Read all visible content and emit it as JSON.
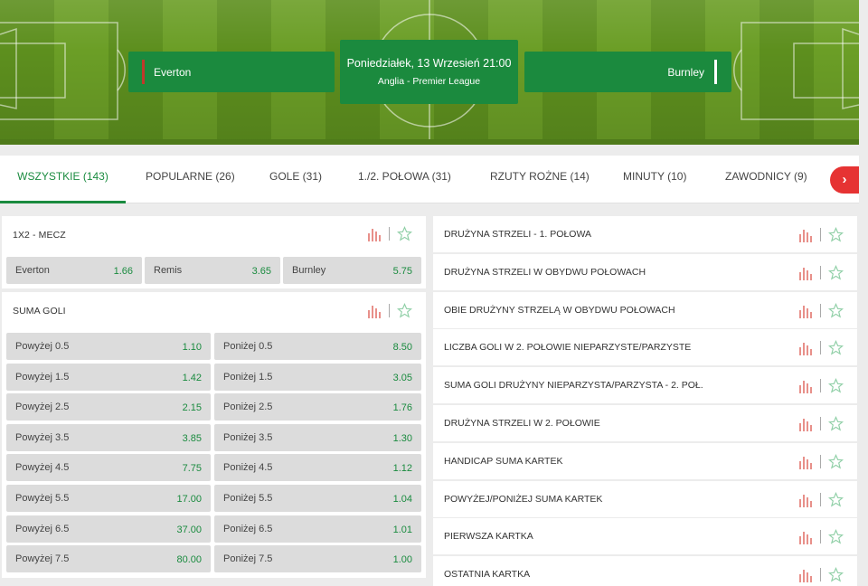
{
  "hero": {
    "home_team": "Everton",
    "away_team": "Burnley",
    "date": "Poniedziałek, 13 Wrzesień 21:00",
    "league": "Anglia - Premier League"
  },
  "tabs": [
    {
      "label": "WSZYSTKIE (143)",
      "active": true
    },
    {
      "label": "POPULARNE (26)"
    },
    {
      "label": "GOLE (31)"
    },
    {
      "label": "1./2. POŁOWA (31)"
    },
    {
      "label": "RZUTY ROŻNE (14)"
    },
    {
      "label": "MINUTY (10)"
    },
    {
      "label": "ZAWODNICY (9)"
    }
  ],
  "tab_next_icon": "chevron-right-icon",
  "match_result": {
    "title": "1X2 - MECZ",
    "odds": [
      {
        "label": "Everton",
        "value": "1.66"
      },
      {
        "label": "Remis",
        "value": "3.65"
      },
      {
        "label": "Burnley",
        "value": "5.75"
      }
    ]
  },
  "total_goals": {
    "title": "SUMA GOLI",
    "rows": [
      {
        "over_label": "Powyżej 0.5",
        "over_value": "1.10",
        "under_label": "Poniżej 0.5",
        "under_value": "8.50"
      },
      {
        "over_label": "Powyżej 1.5",
        "over_value": "1.42",
        "under_label": "Poniżej 1.5",
        "under_value": "3.05"
      },
      {
        "over_label": "Powyżej 2.5",
        "over_value": "2.15",
        "under_label": "Poniżej 2.5",
        "under_value": "1.76"
      },
      {
        "over_label": "Powyżej 3.5",
        "over_value": "3.85",
        "under_label": "Poniżej 3.5",
        "under_value": "1.30"
      },
      {
        "over_label": "Powyżej 4.5",
        "over_value": "7.75",
        "under_label": "Poniżej 4.5",
        "under_value": "1.12"
      },
      {
        "over_label": "Powyżej 5.5",
        "over_value": "17.00",
        "under_label": "Poniżej 5.5",
        "under_value": "1.04"
      },
      {
        "over_label": "Powyżej 6.5",
        "over_value": "37.00",
        "under_label": "Poniżej 6.5",
        "under_value": "1.01"
      },
      {
        "over_label": "Powyżej 7.5",
        "over_value": "80.00",
        "under_label": "Poniżej 7.5",
        "under_value": "1.00"
      }
    ]
  },
  "markets": [
    "DRUŻYNA STRZELI - 1. POŁOWA",
    "DRUŻYNA STRZELI W OBYDWU POŁOWACH",
    "OBIE DRUŻYNY STRZELĄ W OBYDWU POŁOWACH",
    "LICZBA GOLI W 2. POŁOWIE NIEPARZYSTE/PARZYSTE",
    "SUMA GOLI DRUŻYNY NIEPARZYSTA/PARZYSTA - 2. POŁ.",
    "DRUŻYNA STRZELI W 2. POŁOWIE",
    "HANDICAP SUMA KARTEK",
    "POWYŻEJ/PONIŻEJ SUMA KARTEK",
    "PIERWSZA KARTKA",
    "OSTATNIA KARTKA"
  ],
  "colors": {
    "accent": "#1a8b3f",
    "team_box": "#1b8a3e",
    "stats_icon": "#e8908a",
    "star_icon": "#8fcfa6",
    "next_button": "#e63333"
  },
  "icons": {
    "stats": "stats-bars-icon",
    "favorite": "star-icon"
  }
}
